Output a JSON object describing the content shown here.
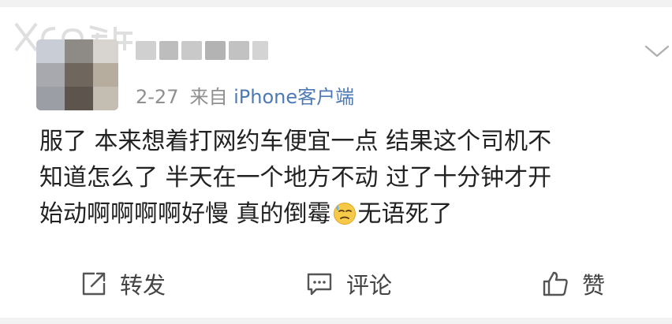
{
  "watermark": {
    "text": "XCAR 爱卡"
  },
  "post": {
    "time": "2-27",
    "source_prefix": "来自",
    "source_app": "iPhone客户端",
    "lines": [
      "服了 本来想着打网约车便宜一点 结果这个司机不",
      "知道怎么了 半天在一个地方不动 过了十分钟才开",
      "始动啊啊啊啊好慢 真的倒霉"
    ],
    "tail": "无语死了",
    "emoji_icon": "sweat-face-emoji"
  },
  "actions": {
    "repost": "转发",
    "comment": "评论",
    "like": "赞"
  },
  "icons": {
    "more": "chevron-down-icon",
    "repost": "repost-icon",
    "comment": "comment-icon",
    "like": "thumbs-up-icon"
  },
  "colors": {
    "link": "#4d7ab5",
    "meta": "#8f8f8f",
    "text": "#222222",
    "background": "#f2f2f2"
  }
}
